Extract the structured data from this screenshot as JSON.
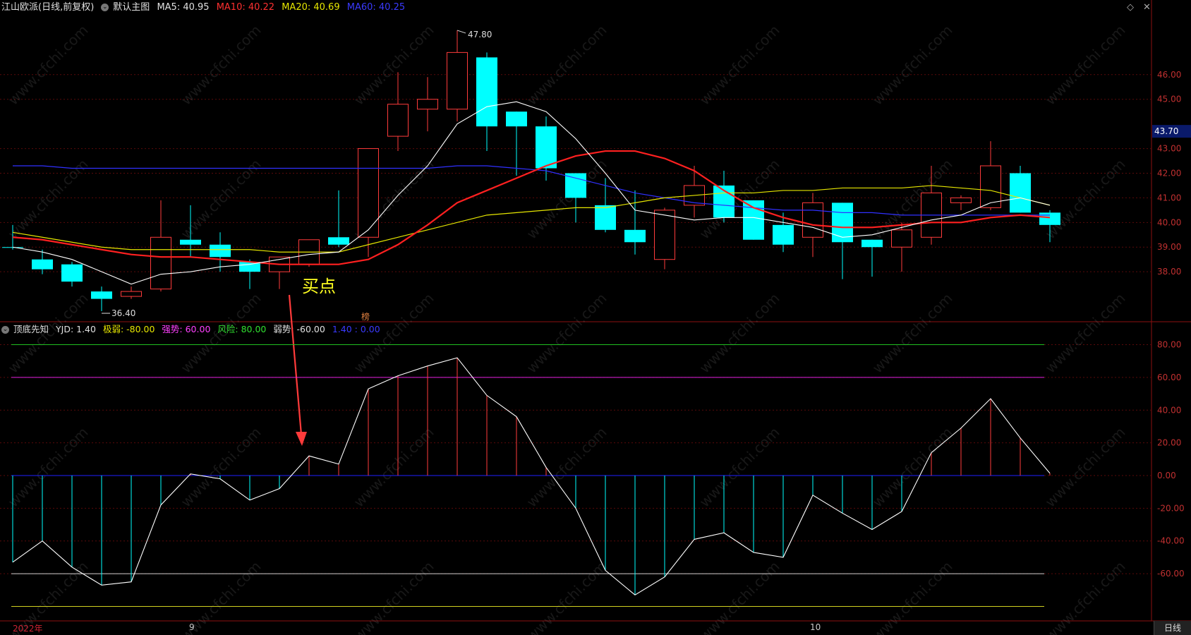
{
  "main_header": {
    "stock": "江山欧派(日线,前复权)",
    "view": "默认主图",
    "ma5": "MA5: 40.95",
    "ma10": "MA10: 40.22",
    "ma20": "MA20: 40.69",
    "ma60": "MA60: 40.25"
  },
  "win_controls": {
    "restore": "◇",
    "close": "✕"
  },
  "price_axis": [
    "46.00",
    "45.00",
    "43.00",
    "42.00",
    "41.00",
    "40.00",
    "39.00",
    "38.00"
  ],
  "current_price": "43.70",
  "annotations": {
    "high": "47.80",
    "low": "36.40",
    "buy": "买点",
    "bang": "榜"
  },
  "sub_header": {
    "name": "顶底先知",
    "yjd": "YJD: 1.40",
    "jiruo": "极弱: -80.00",
    "qiangshi": "强势: 60.00",
    "fengxian": "风险: 80.00",
    "ruoshi": "弱势: -60.00",
    "extra": "1.40 : 0.00"
  },
  "sub_axis": [
    "80.00",
    "60.00",
    "40.00",
    "20.00",
    "0.00",
    "-20.00",
    "-40.00",
    "-60.00"
  ],
  "time_axis": {
    "year": "2022年",
    "sep": "9",
    "oct": "10",
    "period": "日线"
  },
  "colors": {
    "up": "#ff3b3b",
    "down": "#00ffff",
    "ma5": "#ffffff",
    "ma10": "#ff2020",
    "ma20": "#e6e600",
    "ma60": "#3030ff"
  },
  "chart_data": {
    "type": "candlestick",
    "candles": [
      [
        39.0,
        39.9,
        38.9,
        39.0,
        "down"
      ],
      [
        38.5,
        38.9,
        37.9,
        38.1,
        "down"
      ],
      [
        38.3,
        38.4,
        37.4,
        37.6,
        "down"
      ],
      [
        37.2,
        37.4,
        36.4,
        36.9,
        "down"
      ],
      [
        37.0,
        37.4,
        36.9,
        37.2,
        "up"
      ],
      [
        37.3,
        40.9,
        37.2,
        39.4,
        "up"
      ],
      [
        39.1,
        40.7,
        38.6,
        39.3,
        "down"
      ],
      [
        38.6,
        39.6,
        38.0,
        39.1,
        "down"
      ],
      [
        38.0,
        38.5,
        37.3,
        38.4,
        "down"
      ],
      [
        38.0,
        38.6,
        37.3,
        38.6,
        "up"
      ],
      [
        38.3,
        39.3,
        38.2,
        39.3,
        "up"
      ],
      [
        39.1,
        41.3,
        39.0,
        39.4,
        "down"
      ],
      [
        39.4,
        43.0,
        38.6,
        43.0,
        "up"
      ],
      [
        43.5,
        46.1,
        42.9,
        44.8,
        "up"
      ],
      [
        44.6,
        45.9,
        43.7,
        45.0,
        "up"
      ],
      [
        44.6,
        47.8,
        44.1,
        46.9,
        "up"
      ],
      [
        46.7,
        46.9,
        42.9,
        43.9,
        "down"
      ],
      [
        44.5,
        44.5,
        41.9,
        43.9,
        "down"
      ],
      [
        43.9,
        44.3,
        41.7,
        42.2,
        "down"
      ],
      [
        42.0,
        42.0,
        40.0,
        41.0,
        "down"
      ],
      [
        40.7,
        41.8,
        39.6,
        39.7,
        "down"
      ],
      [
        39.7,
        41.3,
        38.7,
        39.2,
        "down"
      ],
      [
        38.5,
        40.6,
        38.1,
        40.5,
        "up"
      ],
      [
        40.7,
        42.3,
        40.2,
        41.5,
        "up"
      ],
      [
        41.5,
        42.1,
        40.0,
        40.2,
        "down"
      ],
      [
        40.9,
        40.9,
        39.3,
        39.3,
        "down"
      ],
      [
        39.9,
        40.4,
        38.8,
        39.1,
        "down"
      ],
      [
        39.4,
        41.2,
        38.6,
        40.8,
        "up"
      ],
      [
        40.8,
        40.8,
        37.7,
        39.2,
        "down"
      ],
      [
        39.3,
        39.3,
        37.8,
        39.0,
        "down"
      ],
      [
        39.0,
        40.0,
        38.0,
        39.7,
        "up"
      ],
      [
        39.4,
        42.3,
        39.1,
        41.2,
        "up"
      ],
      [
        40.8,
        41.1,
        40.5,
        41.0,
        "up"
      ],
      [
        40.6,
        43.3,
        40.5,
        42.3,
        "up"
      ],
      [
        42.0,
        42.3,
        40.4,
        40.4,
        "down"
      ],
      [
        40.4,
        40.5,
        39.2,
        39.9,
        "down"
      ]
    ],
    "ma5": [
      39.0,
      38.8,
      38.5,
      38.0,
      37.5,
      37.9,
      38.0,
      38.2,
      38.3,
      38.5,
      38.7,
      38.8,
      39.7,
      41.1,
      42.3,
      44.0,
      44.7,
      44.9,
      44.5,
      43.4,
      42.0,
      40.5,
      40.3,
      40.1,
      40.2,
      40.2,
      40.0,
      39.8,
      39.4,
      39.5,
      39.8,
      40.1,
      40.3,
      40.8,
      41.0,
      40.7
    ],
    "ma10": [
      39.4,
      39.3,
      39.1,
      38.9,
      38.7,
      38.6,
      38.6,
      38.5,
      38.4,
      38.3,
      38.3,
      38.3,
      38.5,
      39.1,
      39.9,
      40.8,
      41.3,
      41.8,
      42.3,
      42.7,
      42.9,
      42.9,
      42.6,
      42.1,
      41.3,
      40.6,
      40.2,
      39.9,
      39.8,
      39.8,
      39.9,
      40.0,
      40.0,
      40.2,
      40.3,
      40.2
    ],
    "ma20": [
      39.6,
      39.4,
      39.2,
      39.0,
      38.9,
      38.9,
      38.9,
      38.9,
      38.9,
      38.8,
      38.8,
      38.8,
      39.1,
      39.4,
      39.7,
      40.0,
      40.3,
      40.4,
      40.5,
      40.6,
      40.6,
      40.8,
      41.0,
      41.1,
      41.2,
      41.2,
      41.3,
      41.3,
      41.4,
      41.4,
      41.4,
      41.5,
      41.4,
      41.3,
      41.0,
      40.7
    ],
    "ma60": [
      42.3,
      42.3,
      42.2,
      42.2,
      42.2,
      42.2,
      42.2,
      42.2,
      42.2,
      42.2,
      42.2,
      42.2,
      42.2,
      42.2,
      42.2,
      42.3,
      42.3,
      42.2,
      42.1,
      41.8,
      41.5,
      41.2,
      41.0,
      40.8,
      40.7,
      40.6,
      40.5,
      40.5,
      40.4,
      40.4,
      40.3,
      40.3,
      40.3,
      40.3,
      40.3,
      40.3
    ],
    "yjd": [
      -53,
      -40,
      -56,
      -67,
      -65,
      -18,
      1,
      -2,
      -15,
      -8,
      12,
      7,
      53,
      61,
      67,
      72,
      49,
      36,
      5,
      -20,
      -58,
      -73,
      -62,
      -39,
      -35,
      -47,
      -50,
      -12,
      -23,
      -33,
      -22,
      14,
      29,
      47,
      23,
      1.4
    ],
    "levels": {
      "jiruo": -80,
      "qiangshi": 60,
      "fengxian": 80,
      "ruoshi": -60
    },
    "price_range": [
      36.0,
      48.4
    ],
    "yjd_range": [
      -88,
      88
    ]
  }
}
